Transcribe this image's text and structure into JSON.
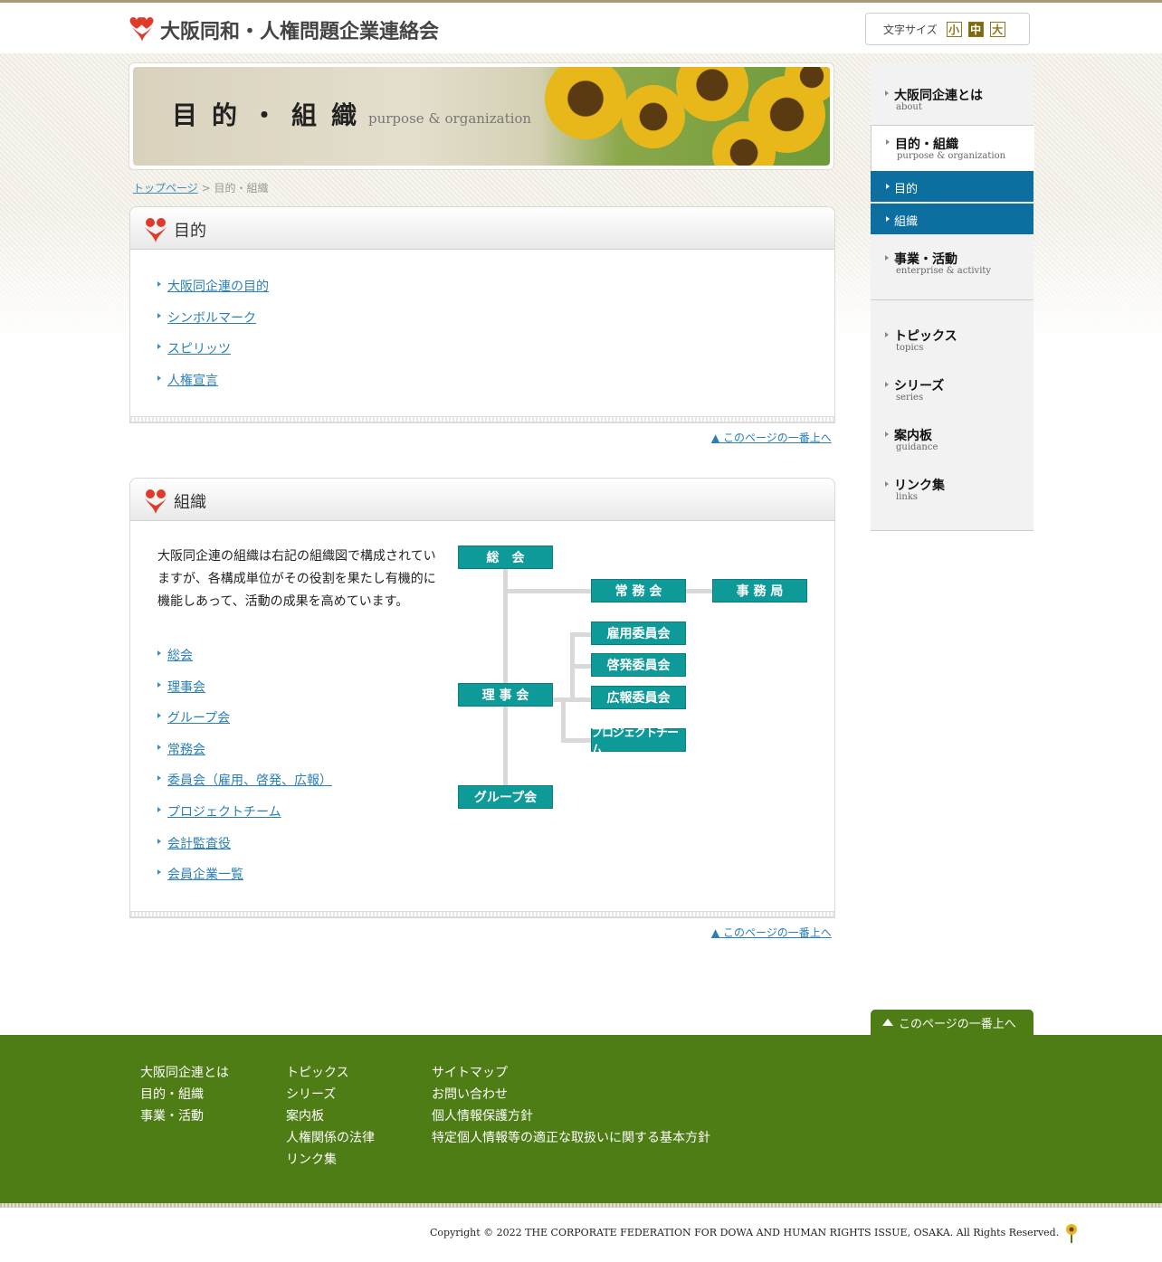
{
  "header": {
    "org_name": "大阪同和・人権問題企業連絡会",
    "fontsize_label": "文字サイズ",
    "fontsize_small": "小",
    "fontsize_medium": "中",
    "fontsize_large": "大"
  },
  "banner": {
    "title": "目的・組織",
    "subtitle": "purpose & organization"
  },
  "breadcrumb": {
    "home": "トップページ",
    "separator": " > ",
    "current": "目的・組織"
  },
  "purpose": {
    "title": "目的",
    "links": [
      "大阪同企連の目的",
      "シンボルマーク",
      "スピリッツ",
      "人権宣言"
    ],
    "totop": "▲ このページの一番上へ"
  },
  "organization": {
    "title": "組織",
    "description": "大阪同企連の組織は右記の組織図で構成されていますが、各構成単位がその役割を果たし有機的に機能しあって、活動の成果を高めています。",
    "links": [
      "総会",
      "理事会",
      "グループ会",
      "常務会",
      "委員会（雇用、啓発、広報）",
      "プロジェクトチーム",
      "会計監査役",
      "会員企業一覧"
    ],
    "totop": "▲ このページの一番上へ",
    "chart": {
      "general_meeting": "総　会",
      "executive": "常 務 会",
      "secretariat": "事 務 局",
      "employment": "雇用委員会",
      "awareness": "啓発委員会",
      "pr": "広報委員会",
      "board": "理 事 会",
      "project": "プロジェクトチーム",
      "group": "グループ会"
    }
  },
  "sidenav": {
    "items": [
      {
        "jp": "大阪同企連とは",
        "en": "about"
      },
      {
        "jp": "目的・組織",
        "en": "purpose & organization"
      },
      {
        "jp": "事業・活動",
        "en": "enterprise & activity"
      },
      {
        "jp": "トピックス",
        "en": "topics"
      },
      {
        "jp": "シリーズ",
        "en": "series"
      },
      {
        "jp": "案内板",
        "en": "guidance"
      },
      {
        "jp": "リンク集",
        "en": "links"
      }
    ],
    "sub": [
      "目的",
      "組織"
    ]
  },
  "totop_tab": "このページの一番上へ",
  "footer": {
    "col1": [
      "大阪同企連とは",
      "目的・組織",
      "事業・活動"
    ],
    "col2": [
      "トピックス",
      "シリーズ",
      "案内板",
      "人権関係の法律",
      "リンク集"
    ],
    "col3": [
      "サイトマップ",
      "お問い合わせ",
      "個人情報保護方針",
      "特定個人情報等の適正な取扱いに関する基本方針"
    ],
    "copyright": "Copyright © 2022 THE CORPORATE FEDERATION FOR DOWA AND HUMAN RIGHTS ISSUE, OSAKA. All Rights Reserved."
  }
}
